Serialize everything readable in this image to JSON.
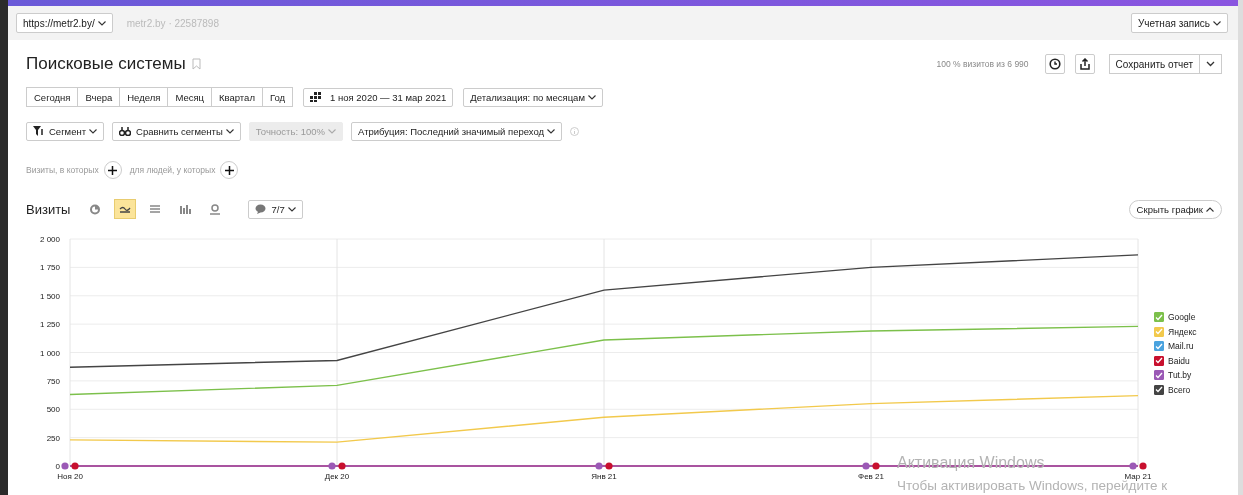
{
  "header": {
    "site_button": "https://metr2.by/",
    "counter": "metr2.by · 22587898",
    "account_button": "Учетная запись"
  },
  "report": {
    "title": "Поисковые системы",
    "sample_info": "100 % визитов из 6 990",
    "save_button": "Сохранить отчет"
  },
  "periods": [
    {
      "label": "Сегодня",
      "selected": false
    },
    {
      "label": "Вчера",
      "selected": false
    },
    {
      "label": "Неделя",
      "selected": false
    },
    {
      "label": "Месяц",
      "selected": false
    },
    {
      "label": "Квартал",
      "selected": false
    },
    {
      "label": "Год",
      "selected": false
    }
  ],
  "date_range": "1 ноя 2020 — 31 мар 2021",
  "detail_dropdown": "Детализация: по месяцам",
  "filters": [
    {
      "kind": "segment",
      "label": "Сегмент",
      "disabled": false
    },
    {
      "kind": "compare",
      "label": "Сравнить сегменты",
      "disabled": false
    },
    {
      "kind": "accuracy",
      "label": "Точность: 100%",
      "disabled": true
    },
    {
      "kind": "attribution",
      "label": "Атрибуция: Последний значимый переход",
      "disabled": false
    }
  ],
  "conditions": [
    {
      "label": "Визиты, в которых"
    },
    {
      "label": "для людей, у которых"
    }
  ],
  "metric": {
    "title": "Визиты",
    "chart_types": [
      {
        "kind": "pie",
        "selected": false
      },
      {
        "kind": "line",
        "selected": true
      },
      {
        "kind": "area",
        "selected": false
      },
      {
        "kind": "bar",
        "selected": false
      },
      {
        "kind": "map",
        "selected": false
      }
    ],
    "notes_button": "7/7",
    "hide_button": "Скрыть график"
  },
  "chart_data": {
    "type": "line",
    "categories": [
      "Ноя 20",
      "Дек 20",
      "Янв 21",
      "Фев 21",
      "Мар 21"
    ],
    "yticks": [
      {
        "value": 0,
        "label": "0"
      },
      {
        "value": 250,
        "label": "250"
      },
      {
        "value": 500,
        "label": "500"
      },
      {
        "value": 750,
        "label": "750"
      },
      {
        "value": 1000,
        "label": "1 000"
      },
      {
        "value": 1250,
        "label": "1 250"
      },
      {
        "value": 1500,
        "label": "1 500"
      },
      {
        "value": 1750,
        "label": "1 750"
      },
      {
        "value": 2000,
        "label": "2 000"
      }
    ],
    "ylim": [
      0,
      2000
    ],
    "grid": true,
    "series": [
      {
        "name": "Google",
        "color": "#7cc04b",
        "values": [
          630,
          710,
          1110,
          1190,
          1230
        ]
      },
      {
        "name": "Яндекс",
        "color": "#f2c94c",
        "values": [
          230,
          210,
          430,
          550,
          620
        ]
      },
      {
        "name": "Mail.ru",
        "color": "#4aa3df",
        "values": [
          null,
          null,
          null,
          null,
          null
        ]
      },
      {
        "name": "Baidu",
        "color": "#c8102e",
        "values": [
          0,
          0,
          0,
          0,
          0
        ],
        "marker": "circle"
      },
      {
        "name": "Tut.by",
        "color": "#9b59b6",
        "values": [
          0,
          0,
          0,
          0,
          0
        ],
        "marker": "circle"
      },
      {
        "name": "Всего",
        "color": "#444444",
        "values": [
          870,
          930,
          1550,
          1750,
          1860
        ]
      }
    ]
  },
  "legend": [
    {
      "checked": true
    },
    {
      "checked": true
    },
    {
      "checked": true
    },
    {
      "checked": true
    },
    {
      "checked": true
    },
    {
      "checked": true
    }
  ],
  "os_notice": {
    "title": "Активация Windows",
    "text": "Чтобы активировать Windows, перейдите к"
  }
}
